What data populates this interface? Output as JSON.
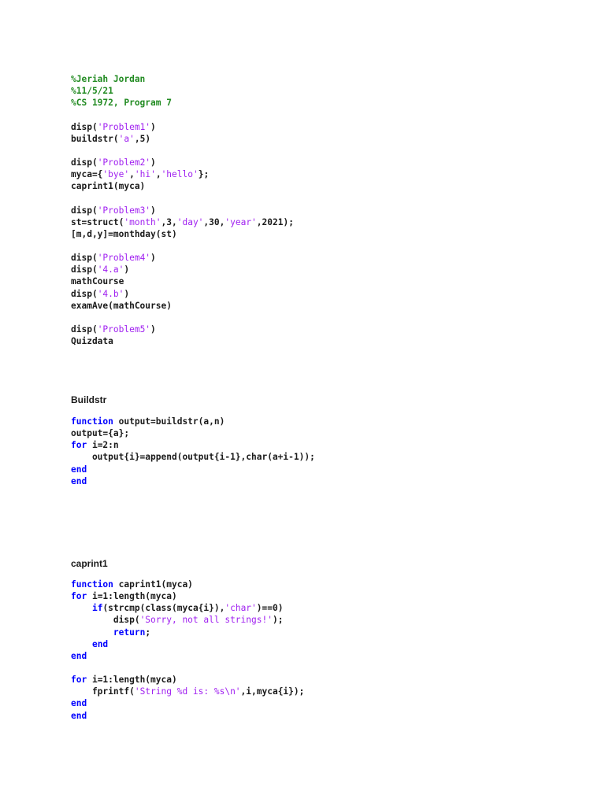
{
  "blocks": [
    {
      "heading": null,
      "lines": [
        [
          [
            "comment",
            "%Jeriah Jordan"
          ]
        ],
        [
          [
            "comment",
            "%11/5/21"
          ]
        ],
        [
          [
            "comment",
            "%CS 1972, Program 7"
          ]
        ],
        [],
        [
          [
            "plain",
            "disp("
          ],
          [
            "string",
            "'Problem1'"
          ],
          [
            "plain",
            ")"
          ]
        ],
        [
          [
            "plain",
            "buildstr("
          ],
          [
            "string",
            "'a'"
          ],
          [
            "plain",
            ",5)"
          ]
        ],
        [],
        [
          [
            "plain",
            "disp("
          ],
          [
            "string",
            "'Problem2'"
          ],
          [
            "plain",
            ")"
          ]
        ],
        [
          [
            "plain",
            "myca={"
          ],
          [
            "string",
            "'bye'"
          ],
          [
            "plain",
            ","
          ],
          [
            "string",
            "'hi'"
          ],
          [
            "plain",
            ","
          ],
          [
            "string",
            "'hello'"
          ],
          [
            "plain",
            "};"
          ]
        ],
        [
          [
            "plain",
            "caprint1(myca)"
          ]
        ],
        [],
        [
          [
            "plain",
            "disp("
          ],
          [
            "string",
            "'Problem3'"
          ],
          [
            "plain",
            ")"
          ]
        ],
        [
          [
            "plain",
            "st=struct("
          ],
          [
            "string",
            "'month'"
          ],
          [
            "plain",
            ",3,"
          ],
          [
            "string",
            "'day'"
          ],
          [
            "plain",
            ",30,"
          ],
          [
            "string",
            "'year'"
          ],
          [
            "plain",
            ",2021);"
          ]
        ],
        [
          [
            "plain",
            "[m,d,y]=monthday(st)"
          ]
        ],
        [],
        [
          [
            "plain",
            "disp("
          ],
          [
            "string",
            "'Problem4'"
          ],
          [
            "plain",
            ")"
          ]
        ],
        [
          [
            "plain",
            "disp("
          ],
          [
            "string",
            "'4.a'"
          ],
          [
            "plain",
            ")"
          ]
        ],
        [
          [
            "plain",
            "mathCourse"
          ]
        ],
        [
          [
            "plain",
            "disp("
          ],
          [
            "string",
            "'4.b'"
          ],
          [
            "plain",
            ")"
          ]
        ],
        [
          [
            "plain",
            "examAve(mathCourse)"
          ]
        ],
        [],
        [
          [
            "plain",
            "disp("
          ],
          [
            "string",
            "'Problem5'"
          ],
          [
            "plain",
            ")"
          ]
        ],
        [
          [
            "plain",
            "Quizdata"
          ]
        ]
      ]
    },
    {
      "heading": "Buildstr",
      "lines": [
        [
          [
            "keyword",
            "function"
          ],
          [
            "plain",
            " output=buildstr(a,n)"
          ]
        ],
        [
          [
            "plain",
            "output={a};"
          ]
        ],
        [
          [
            "keyword",
            "for"
          ],
          [
            "plain",
            " i=2:n"
          ]
        ],
        [
          [
            "plain",
            "    output{i}=append(output{i-1},char(a+i-1));"
          ]
        ],
        [
          [
            "keyword",
            "end"
          ]
        ],
        [
          [
            "keyword",
            "end"
          ]
        ]
      ]
    },
    {
      "heading": "caprint1",
      "lines": [
        [
          [
            "keyword",
            "function"
          ],
          [
            "plain",
            " caprint1(myca)"
          ]
        ],
        [
          [
            "keyword",
            "for"
          ],
          [
            "plain",
            " i=1:length(myca)"
          ]
        ],
        [
          [
            "plain",
            "    "
          ],
          [
            "keyword",
            "if"
          ],
          [
            "plain",
            "(strcmp(class(myca{i}),"
          ],
          [
            "string",
            "'char'"
          ],
          [
            "plain",
            ")==0)"
          ]
        ],
        [
          [
            "plain",
            "        disp("
          ],
          [
            "string",
            "'Sorry, not all strings!'"
          ],
          [
            "plain",
            ");"
          ]
        ],
        [
          [
            "plain",
            "        "
          ],
          [
            "keyword",
            "return"
          ],
          [
            "plain",
            ";"
          ]
        ],
        [
          [
            "plain",
            "    "
          ],
          [
            "keyword",
            "end"
          ]
        ],
        [
          [
            "keyword",
            "end"
          ]
        ],
        [],
        [
          [
            "keyword",
            "for"
          ],
          [
            "plain",
            " i=1:length(myca)"
          ]
        ],
        [
          [
            "plain",
            "    fprintf("
          ],
          [
            "string",
            "'String %d is: %s\\n'"
          ],
          [
            "plain",
            ",i,myca{i});"
          ]
        ],
        [
          [
            "keyword",
            "end"
          ]
        ],
        [
          [
            "keyword",
            "end"
          ]
        ]
      ]
    }
  ],
  "colors": {
    "comment": "#228B22",
    "string": "#A020F0",
    "keyword": "#0000FF",
    "plain": "#1a1a1a"
  }
}
